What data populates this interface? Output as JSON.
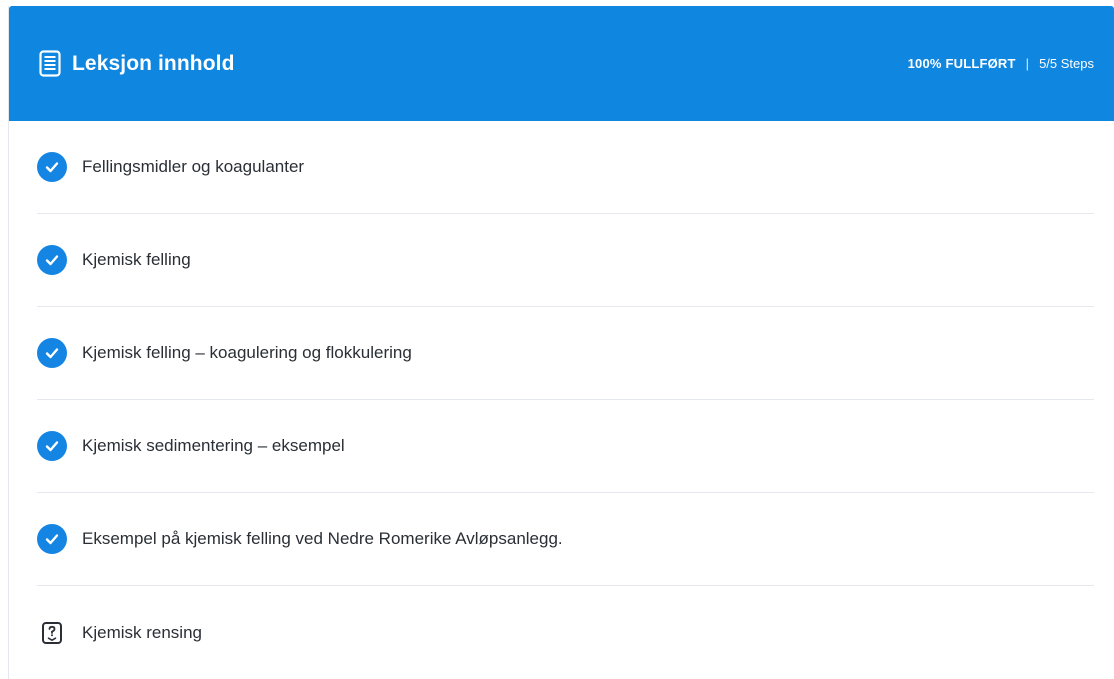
{
  "header": {
    "title": "Leksjon innhold",
    "progress": "100% FULLFØRT",
    "separator": "|",
    "steps": "5/5 Steps",
    "background": "#0f86e0"
  },
  "items": [
    {
      "label": "Fellingsmidler og koagulanter",
      "status": "completed",
      "icon": "check-circle-icon"
    },
    {
      "label": "Kjemisk felling",
      "status": "completed",
      "icon": "check-circle-icon"
    },
    {
      "label": "Kjemisk felling – koagulering og flokkulering",
      "status": "completed",
      "icon": "check-circle-icon"
    },
    {
      "label": "Kjemisk sedimentering – eksempel",
      "status": "completed",
      "icon": "check-circle-icon"
    },
    {
      "label": "Eksempel på kjemisk felling ved Nedre Romerike Avløpsanlegg.",
      "status": "completed",
      "icon": "check-circle-icon"
    },
    {
      "label": "Kjemisk rensing",
      "status": "quiz",
      "icon": "quiz-icon"
    }
  ],
  "colors": {
    "accent": "#1585e4",
    "text": "#2a2f36",
    "divider": "#e5e8ee"
  }
}
